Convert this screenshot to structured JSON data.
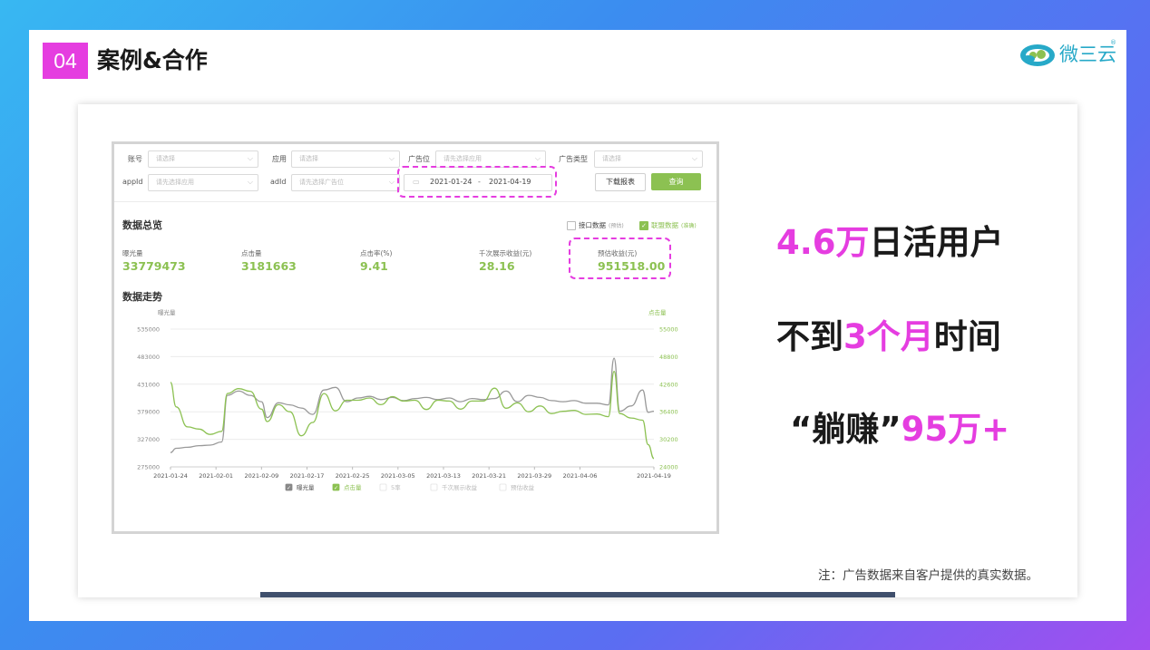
{
  "header": {
    "badge": "04",
    "title": "案例&合作"
  },
  "logo": {
    "text": "微三云",
    "reg": "®"
  },
  "filters": {
    "account_label": "账号",
    "account_placeholder": "请选择",
    "app_label": "应用",
    "app_placeholder": "请选择",
    "adpos_label": "广告位",
    "adpos_placeholder": "请先选择应用",
    "adtype_label": "广告类型",
    "adtype_placeholder": "请选择",
    "appid_label": "appId",
    "appid_placeholder": "请先选择应用",
    "adid_label": "adId",
    "adid_placeholder": "请先选择广告位",
    "date_start": "2021-01-24",
    "date_sep": "-",
    "date_end": "2021-04-19",
    "download_label": "下载报表",
    "query_label": "查询"
  },
  "overview": {
    "title": "数据总览",
    "check_api": "接口数据",
    "check_api_sub": "(预估)",
    "check_union": "联盟数据",
    "check_union_sub": "(准确)",
    "metrics": [
      {
        "label": "曝光量",
        "value": "33779473"
      },
      {
        "label": "点击量",
        "value": "3181663"
      },
      {
        "label": "点击率(%)",
        "value": "9.41"
      },
      {
        "label": "千次展示收益(元)",
        "value": "28.16"
      },
      {
        "label": "预估收益(元)",
        "value": "951518.00"
      }
    ]
  },
  "trend": {
    "title": "数据走势"
  },
  "chart_data": {
    "type": "line",
    "y_left_label": "曝光量",
    "y_right_label": "点击量",
    "y_left_ticks": [
      "535000",
      "483000",
      "431000",
      "379000",
      "327000",
      "275000"
    ],
    "y_right_ticks": [
      "55000",
      "48800",
      "42600",
      "36400",
      "30200",
      "24000"
    ],
    "ylim_left": [
      275000,
      535000
    ],
    "ylim_right": [
      24000,
      55000
    ],
    "x_ticks": [
      "2021-01-24",
      "2021-02-01",
      "2021-02-09",
      "2021-02-17",
      "2021-02-25",
      "2021-03-05",
      "2021-03-13",
      "2021-03-21",
      "2021-03-29",
      "2021-04-06",
      "2021-04-19"
    ],
    "x": [
      "2021-01-24",
      "2021-01-25",
      "2021-01-27",
      "2021-01-29",
      "2021-01-31",
      "2021-02-02",
      "2021-02-03",
      "2021-02-05",
      "2021-02-07",
      "2021-02-09",
      "2021-02-10",
      "2021-02-12",
      "2021-02-14",
      "2021-02-16",
      "2021-02-18",
      "2021-02-20",
      "2021-02-22",
      "2021-02-24",
      "2021-02-26",
      "2021-02-28",
      "2021-03-02",
      "2021-03-04",
      "2021-03-06",
      "2021-03-08",
      "2021-03-10",
      "2021-03-12",
      "2021-03-14",
      "2021-03-16",
      "2021-03-18",
      "2021-03-20",
      "2021-03-22",
      "2021-03-24",
      "2021-03-26",
      "2021-03-28",
      "2021-03-30",
      "2021-04-01",
      "2021-04-03",
      "2021-04-05",
      "2021-04-07",
      "2021-04-09",
      "2021-04-11",
      "2021-04-12",
      "2021-04-13",
      "2021-04-15",
      "2021-04-17",
      "2021-04-18",
      "2021-04-19"
    ],
    "series": [
      {
        "name": "曝光量",
        "color": "#999999",
        "values": [
          302000,
          310000,
          312000,
          315000,
          316000,
          322000,
          410000,
          418000,
          410000,
          398000,
          368000,
          396000,
          392000,
          386000,
          374000,
          420000,
          425000,
          398000,
          405000,
          408000,
          402000,
          406000,
          400000,
          404000,
          406000,
          402000,
          405000,
          398000,
          404000,
          402000,
          404000,
          418000,
          398000,
          410000,
          406000,
          400000,
          398000,
          400000,
          395000,
          395000,
          392000,
          480000,
          380000,
          390000,
          420000,
          378000,
          380000
        ]
      },
      {
        "name": "点击量",
        "color": "#8cc152",
        "values": [
          43000,
          37500,
          33000,
          32500,
          31300,
          32000,
          40500,
          41600,
          41000,
          37000,
          34200,
          38000,
          36400,
          31000,
          34000,
          40500,
          36600,
          39000,
          39000,
          39500,
          38000,
          39800,
          38800,
          39000,
          36900,
          39000,
          38800,
          37000,
          38800,
          38800,
          41700,
          37200,
          38400,
          36400,
          37700,
          36000,
          36500,
          36700,
          35800,
          35900,
          35300,
          45500,
          36000,
          35000,
          34500,
          29000,
          25900
        ]
      }
    ],
    "legend": [
      "曝光量",
      "点击量",
      "5率",
      "千次展示收益",
      "预估收益"
    ],
    "grid": true,
    "legend_position": "bottom"
  },
  "highlights": {
    "l1_pink": "4.6万",
    "l1_rest": "日活用户",
    "l2_a": "不到",
    "l2_pink": "3个月",
    "l2_b": "时间",
    "l3_a": "“躺赚”",
    "l3_pink": "95万+"
  },
  "footnote": "注：广告数据来自客户提供的真实数据。"
}
